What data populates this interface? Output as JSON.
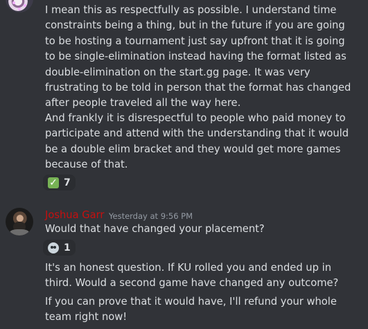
{
  "messages": {
    "first": {
      "paragraph1": "I mean this as respectfully as possible. I understand time constraints being a thing, but in the future if you are going to be hosting a tournament just say upfront that it is going to be single-elimination instead having the format listed as double-elimination on the start.gg page. It was very frustrating to be told in person that the format has changed after people traveled all the way here.",
      "paragraph2": "And frankly it is disrespectful to people who paid money to participate and attend with the understanding that it would be a double elim bracket and they would get more games because of that.",
      "reaction": {
        "emoji": "✅",
        "count": "7"
      }
    },
    "joshua": {
      "author": "Joshua Garr",
      "timestamp": "Yesterday at 9:56 PM",
      "line1": "Would that have changed your placement?",
      "reaction": {
        "emoji": "skull-emoji",
        "count": "1"
      },
      "paragraph2": "It's an honest question. If KU rolled you and ended up in third. Would a second game have changed any outcome?",
      "paragraph3": "If you can prove that it would have, I'll refund your whole team right now!"
    }
  },
  "colors": {
    "background": "#313338",
    "text": "#dbdee1",
    "author_name": "#c70f0f",
    "timestamp": "#949ba4",
    "reaction_bg": "#2b2d31"
  }
}
